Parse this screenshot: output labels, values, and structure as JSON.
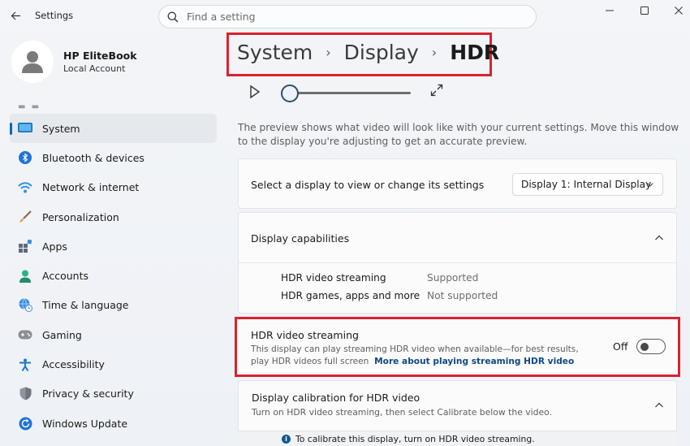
{
  "window": {
    "title": "Settings"
  },
  "search": {
    "placeholder": "Find a setting"
  },
  "profile": {
    "name": "HP EliteBook",
    "account": "Local Account"
  },
  "sidebar": {
    "items": [
      {
        "label": "System",
        "icon": "monitor-icon",
        "active": true
      },
      {
        "label": "Bluetooth & devices",
        "icon": "bluetooth-icon"
      },
      {
        "label": "Network & internet",
        "icon": "wifi-icon"
      },
      {
        "label": "Personalization",
        "icon": "brush-icon"
      },
      {
        "label": "Apps",
        "icon": "apps-icon"
      },
      {
        "label": "Accounts",
        "icon": "person-icon"
      },
      {
        "label": "Time & language",
        "icon": "globe-clock-icon"
      },
      {
        "label": "Gaming",
        "icon": "gamepad-icon"
      },
      {
        "label": "Accessibility",
        "icon": "accessibility-icon"
      },
      {
        "label": "Privacy & security",
        "icon": "shield-icon"
      },
      {
        "label": "Windows Update",
        "icon": "update-icon"
      }
    ]
  },
  "breadcrumb": {
    "items": [
      "System",
      "Display"
    ],
    "current": "HDR",
    "separator": "›"
  },
  "preview": {
    "description": "The preview shows what video will look like with your current settings. Move this window to the display you're adjusting to get an accurate preview."
  },
  "display_select": {
    "label": "Select a display to view or change its settings",
    "value": "Display 1: Internal Display"
  },
  "capabilities": {
    "title": "Display capabilities",
    "rows": [
      {
        "name": "HDR video streaming",
        "value": "Supported"
      },
      {
        "name": "HDR games, apps and more",
        "value": "Not supported"
      }
    ]
  },
  "hdr_streaming": {
    "title": "HDR video streaming",
    "description": "This display can play streaming HDR video when available—for best results, play HDR videos full screen",
    "link": "More about playing streaming HDR video",
    "toggle_label": "Off",
    "enabled": false
  },
  "calibration": {
    "title": "Display calibration for HDR video",
    "subtitle": "Turn on HDR video streaming, then select Calibrate below the video.",
    "info": "To calibrate this display, turn on HDR video streaming."
  },
  "colors": {
    "accent": "#0067c0",
    "highlight_box": "#d9232f"
  }
}
